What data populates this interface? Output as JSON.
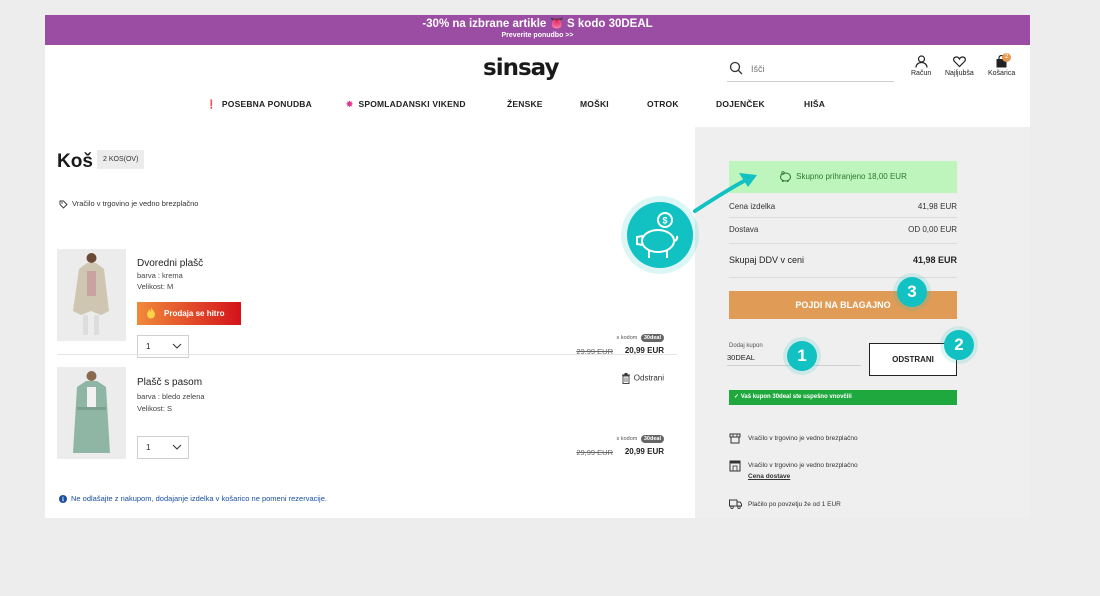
{
  "promo": {
    "text": "-30% na izbrane artikle 👅 S kodo 30DEAL",
    "link": "Preverite ponudbo >>"
  },
  "header": {
    "logo": "sinsay",
    "search_placeholder": "Išči",
    "account_label": "Račun",
    "wishlist_label": "Najljubša",
    "cart_label": "Košarica",
    "cart_count": "2"
  },
  "nav": {
    "items": [
      "POSEBNA PONUDBA",
      "SPOMLADANSKI VIKEND",
      "ŽENSKE",
      "MOŠKI",
      "OTROK",
      "DOJENČEK",
      "HIŠA"
    ]
  },
  "cart": {
    "title": "Koš",
    "count": "2 KOS(OV)",
    "store_note": "Vračilo v trgovino je vedno brezplačno",
    "products": [
      {
        "name": "Dvoredni plašč",
        "color": "barva : krema",
        "size": "Velikost: M",
        "hot_label": "Prodaja se hitro",
        "qty": "1",
        "code_prefix": "s kodom",
        "code": "30deal",
        "old_price": "29,99 EUR",
        "new_price": "20,99 EUR"
      },
      {
        "name": "Plašč s pasom",
        "color": "barva : bledo zelena",
        "size": "Velikost: S",
        "remove_label": "Odstrani",
        "qty": "1",
        "code_prefix": "s kodom",
        "code": "30deal",
        "old_price": "29,99 EUR",
        "new_price": "20,99 EUR"
      }
    ],
    "info_note": "Ne odlašajte z nakupom, dodajanje izdelka v košarico ne pomeni rezervacije."
  },
  "summary": {
    "savings": "Skupno prihranjeno 18,00 EUR",
    "item_price_label": "Cena izdelka",
    "item_price": "41,98 EUR",
    "delivery_label": "Dostava",
    "delivery": "OD 0,00 EUR",
    "total_label": "Skupaj DDV v ceni",
    "total": "41,98 EUR",
    "checkout": "POJDI NA BLAGAJNO",
    "coupon_label": "Dodaj kupon",
    "coupon_value": "30DEAL",
    "remove_btn": "ODSTRANI",
    "success": "Vaš kupon 30deal ste uspešno vnovčili",
    "features": [
      {
        "text": "Vračilo v trgovino je vedno brezplačno",
        "icon": "store-icon"
      },
      {
        "text": "Vračilo v trgovino je vedno brezplačno",
        "link": "Cena dostave",
        "icon": "shop-icon"
      },
      {
        "text": "Plačilo po povzetju že od 1 EUR",
        "icon": "truck-icon"
      }
    ]
  },
  "steps": [
    "1",
    "2",
    "3"
  ],
  "colors": {
    "promo_bg": "#9b4ca3",
    "checkout": "#e09c56",
    "savings_bg": "#bdf5bd",
    "success": "#1fa83e",
    "step": "#12c1c1",
    "hot_start": "#f08a3a",
    "hot_end": "#d4121a"
  }
}
